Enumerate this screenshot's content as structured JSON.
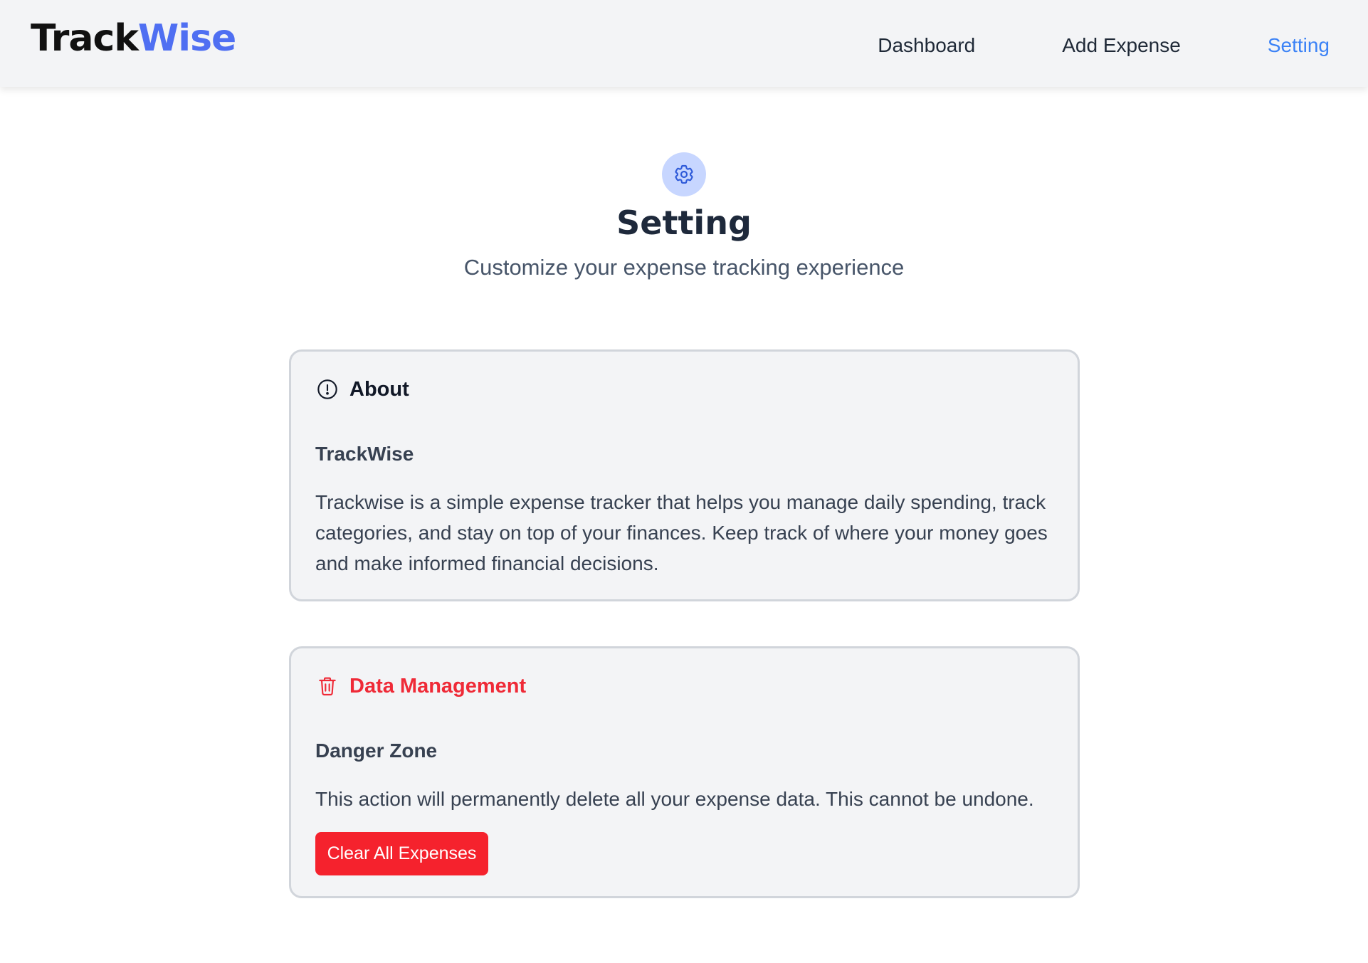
{
  "app": {
    "logo_part1": "Track",
    "logo_part2": "Wise",
    "brand_color": "#4f6ff2"
  },
  "nav": {
    "items": [
      {
        "label": "Dashboard",
        "active": false
      },
      {
        "label": "Add Expense",
        "active": false
      },
      {
        "label": "Setting",
        "active": true
      }
    ],
    "active_color": "#3b82f6"
  },
  "page": {
    "icon": "gear-icon",
    "title": "Setting",
    "subtitle": "Customize your expense tracking experience"
  },
  "about": {
    "icon": "info-circle-icon",
    "heading": "About",
    "subheading": "TrackWise",
    "description": "Trackwise is a simple expense tracker that helps you manage daily spending, track categories, and stay on top of your finances. Keep track of where your money goes and make informed financial decisions."
  },
  "data_management": {
    "icon": "trash-icon",
    "heading": "Data Management",
    "subheading": "Danger Zone",
    "warning": "This action will permanently delete all your expense data. This cannot be undone.",
    "button_label": "Clear All Expenses",
    "danger_color": "#f5222d"
  }
}
